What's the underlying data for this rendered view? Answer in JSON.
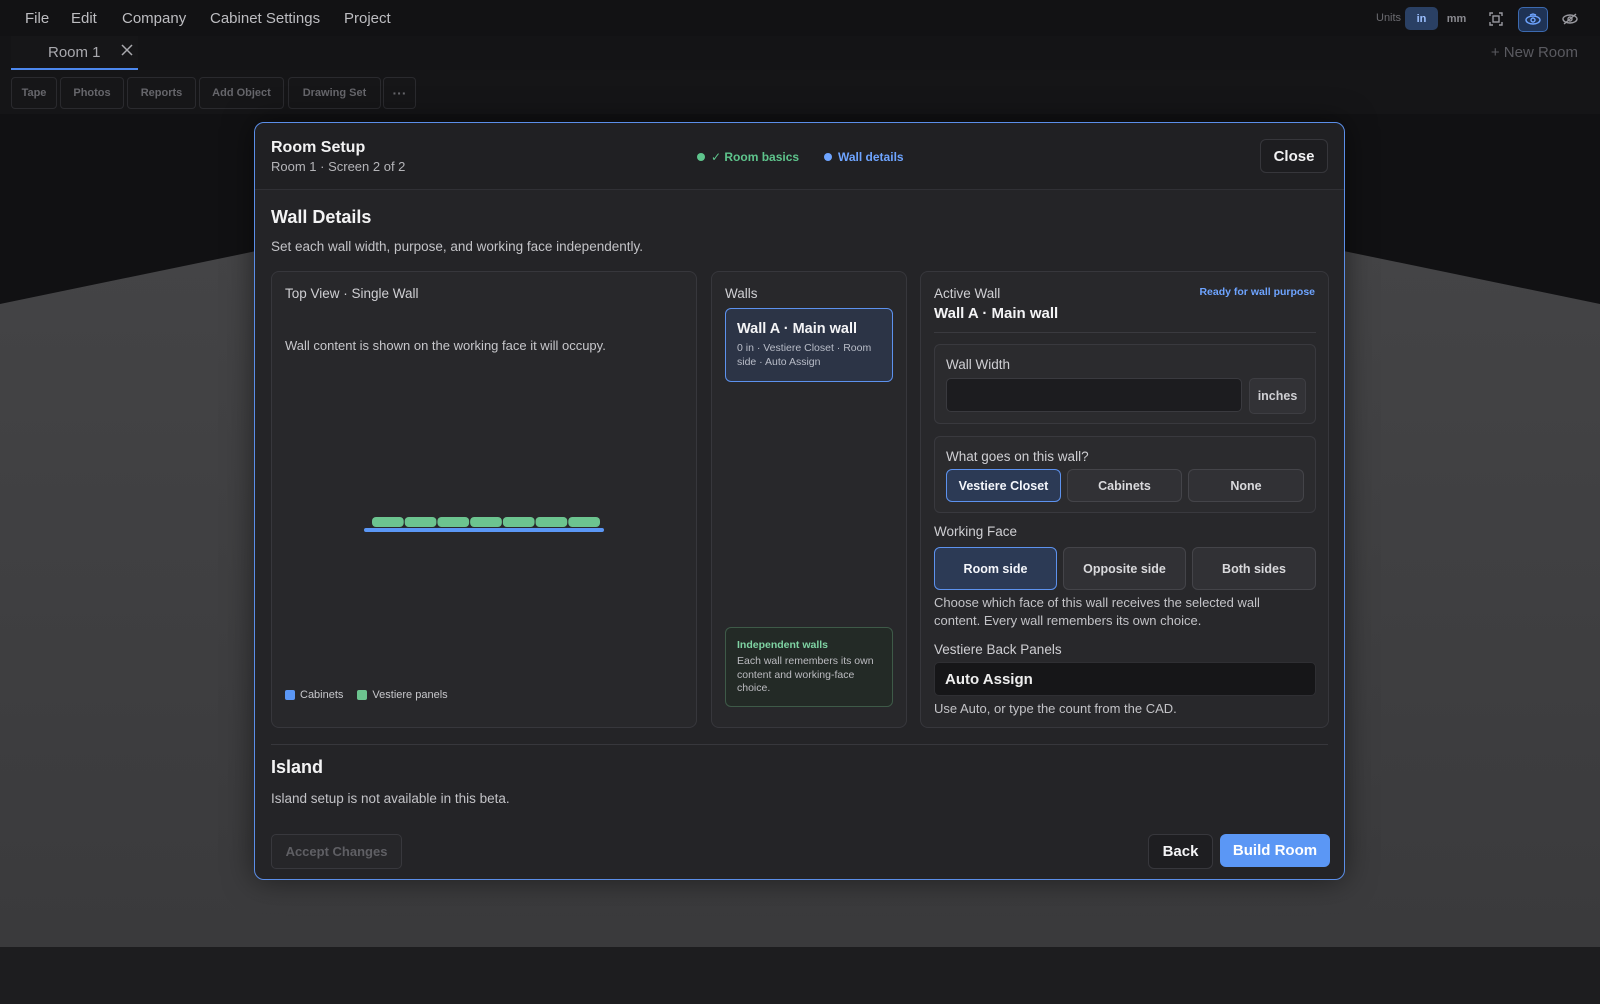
{
  "menu": {
    "items": [
      "File",
      "Edit",
      "Company",
      "Cabinet Settings",
      "Project"
    ]
  },
  "units": {
    "label": "Units",
    "options": [
      "in",
      "mm"
    ],
    "selected": "in"
  },
  "tabs": {
    "room_tab": "Room 1",
    "new_room": "+ New Room"
  },
  "toolbar": {
    "buttons": [
      "Tape",
      "Photos",
      "Reports",
      "Add Object",
      "Drawing Set"
    ],
    "more": "···"
  },
  "modal": {
    "title": "Room Setup",
    "subtitle": "Room 1 · Screen 2 of 2",
    "steps": [
      {
        "label": "✓ Room basics",
        "color": "#5ec48c"
      },
      {
        "label": "Wall details",
        "color": "#6ea4ff"
      }
    ],
    "close": "Close",
    "wall_details": {
      "title": "Wall Details",
      "description": "Set each wall width, purpose, and working face independently."
    },
    "top_view": {
      "title": "Top View · Single Wall",
      "description": "Wall content is shown on the working face it will occupy.",
      "panel_count": 7,
      "legend": [
        {
          "label": "Cabinets",
          "color": "#5b97f5"
        },
        {
          "label": "Vestiere panels",
          "color": "#6cc48f"
        }
      ]
    },
    "walls": {
      "title": "Walls",
      "card": {
        "title": "Wall A · Main wall",
        "meta": "0 in · Vestiere Closet · Room side · Auto Assign"
      },
      "note": {
        "title": "Independent walls",
        "body": "Each wall remembers its own content and working-face choice."
      }
    },
    "active_wall": {
      "label": "Active Wall",
      "name": "Wall A · Main wall",
      "badge": "Ready for wall purpose",
      "width_label": "Wall Width",
      "width_value": "",
      "width_unit": "inches",
      "purpose_label": "What goes on this wall?",
      "purpose_options": [
        "Vestiere Closet",
        "Cabinets",
        "None"
      ],
      "purpose_selected": 0,
      "face_label": "Working Face",
      "face_options": [
        "Room side",
        "Opposite side",
        "Both sides"
      ],
      "face_selected": 0,
      "face_help": "Choose which face of this wall receives the selected wall content. Every wall remembers its own choice.",
      "panels_label": "Vestiere Back Panels",
      "panels_value": "Auto Assign",
      "panels_help": "Use Auto, or type the count from the CAD."
    },
    "island": {
      "title": "Island",
      "description": "Island setup is not available in this beta."
    },
    "footer": {
      "accept": "Accept Changes",
      "back": "Back",
      "build": "Build Room"
    }
  }
}
